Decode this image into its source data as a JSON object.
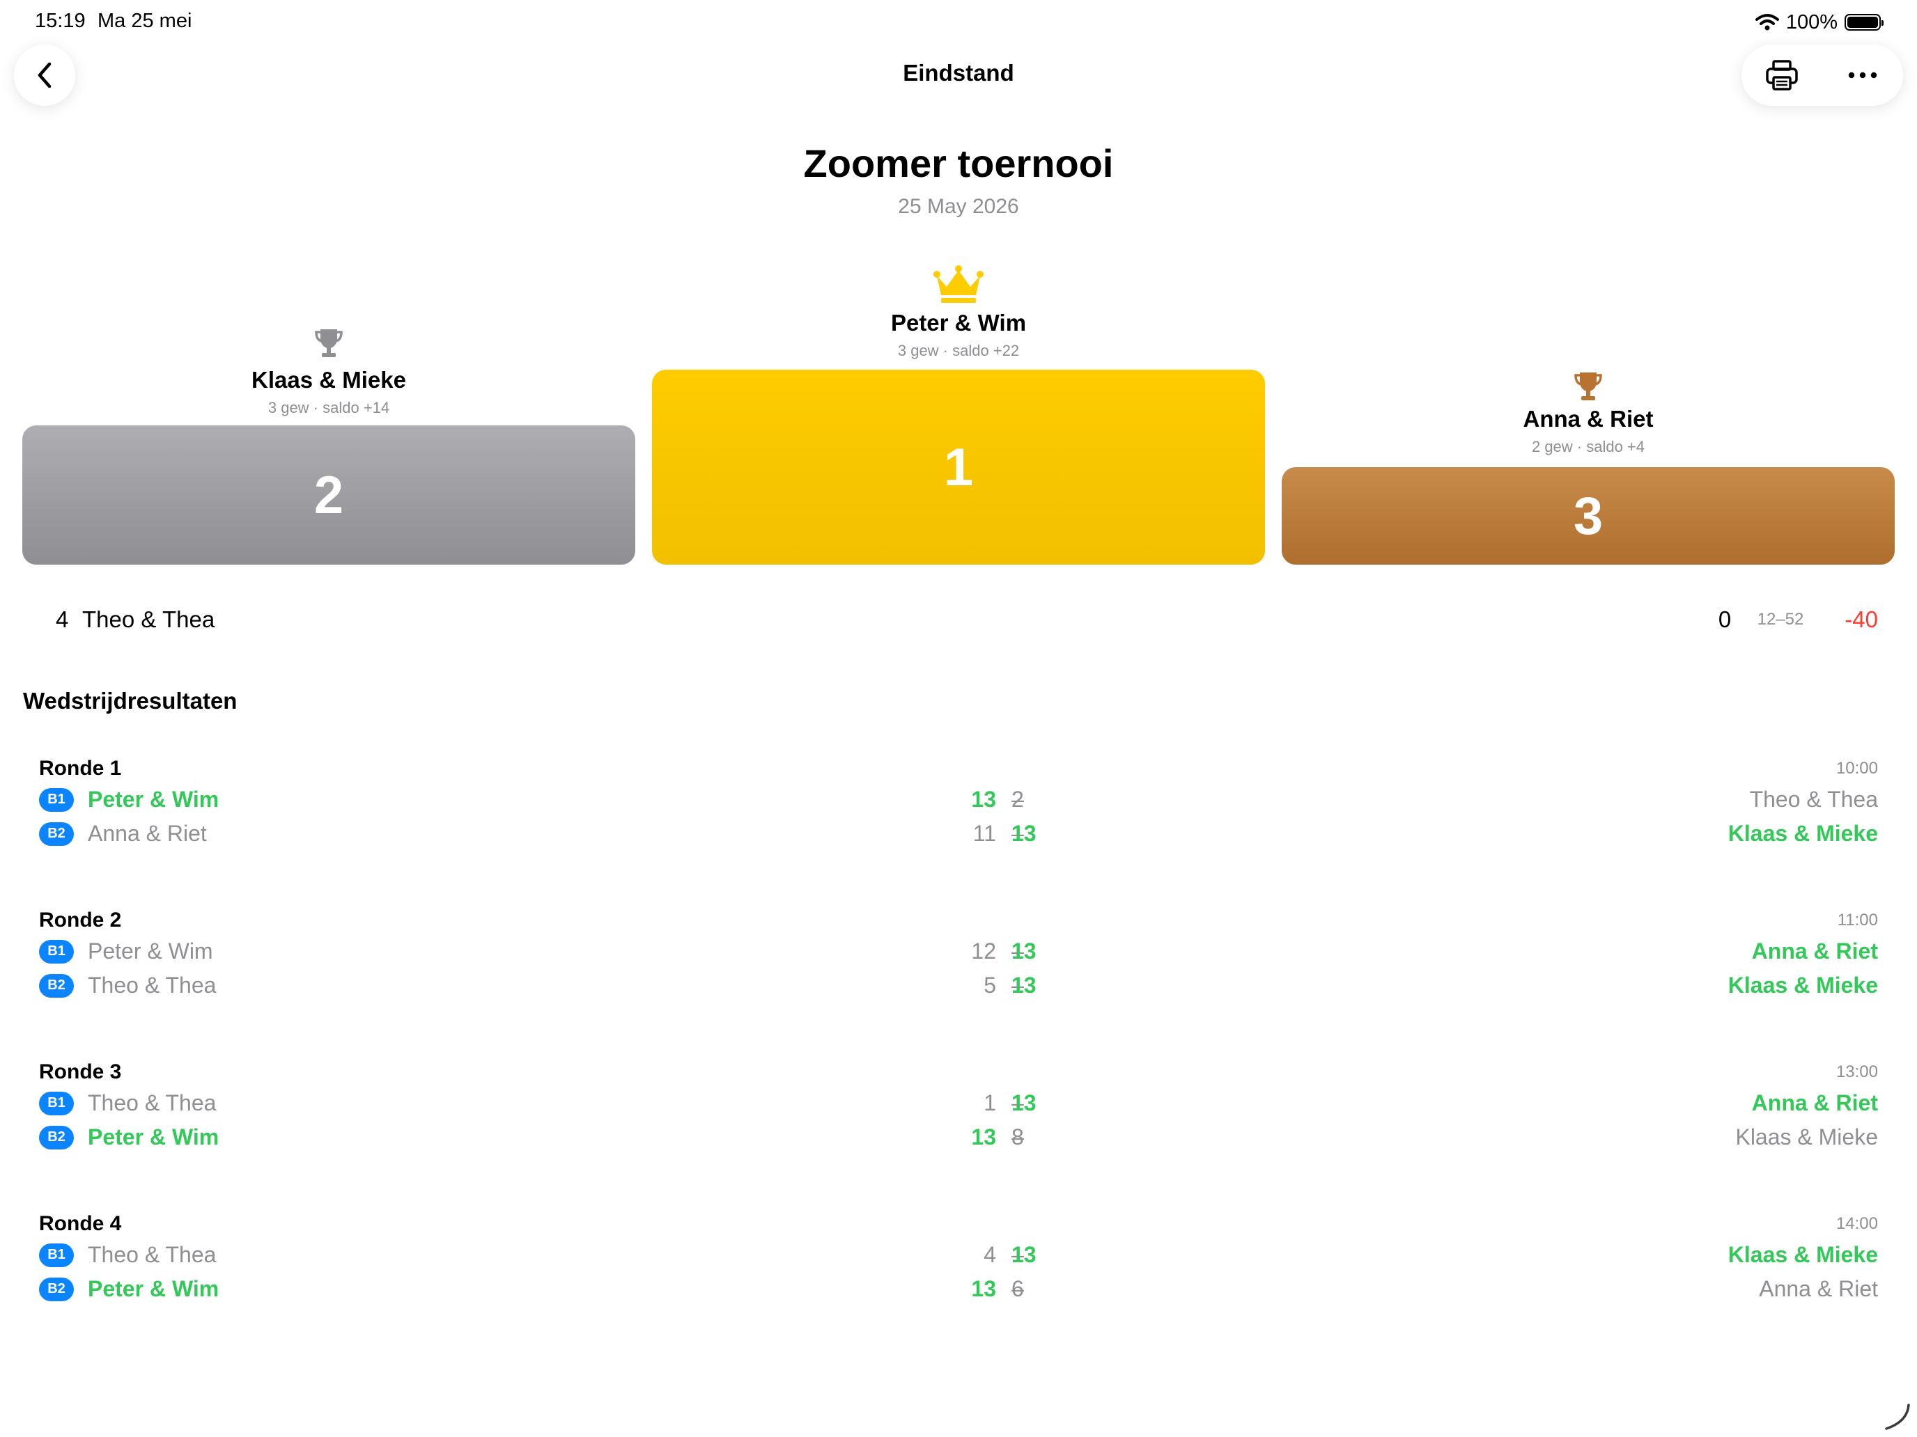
{
  "status_bar": {
    "time": "15:19",
    "date": "Ma 25 mei",
    "battery": "100%"
  },
  "nav": {
    "title": "Eindstand"
  },
  "header": {
    "title": "Zoomer toernooi",
    "date": "25 May 2026"
  },
  "podium": {
    "first": {
      "team": "Peter & Wim",
      "stats": "3 gew · saldo +22",
      "rank": "1"
    },
    "second": {
      "team": "Klaas & Mieke",
      "stats": "3 gew · saldo +14",
      "rank": "2"
    },
    "third": {
      "team": "Anna & Riet",
      "stats": "2 gew · saldo +4",
      "rank": "3"
    }
  },
  "other_standings": [
    {
      "rank": "4",
      "team": "Theo & Thea",
      "wins": "0",
      "points": "12–52",
      "saldo": "-40"
    }
  ],
  "results": {
    "section_title": "Wedstrijdresultaten",
    "rounds": [
      {
        "title": "Ronde 1",
        "time": "10:00",
        "matches": [
          {
            "court": "B1",
            "team_a": "Peter & Wim",
            "score_a": "13",
            "dash": "–",
            "score_b": "2",
            "team_b": "Theo & Thea"
          },
          {
            "court": "B2",
            "team_a": "Anna & Riet",
            "score_a": "11",
            "dash": "–",
            "score_b": "13",
            "team_b": "Klaas & Mieke"
          }
        ]
      },
      {
        "title": "Ronde 2",
        "time": "11:00",
        "matches": [
          {
            "court": "B1",
            "team_a": "Peter & Wim",
            "score_a": "12",
            "dash": "–",
            "score_b": "13",
            "team_b": "Anna & Riet"
          },
          {
            "court": "B2",
            "team_a": "Theo & Thea",
            "score_a": "5",
            "dash": "–",
            "score_b": "13",
            "team_b": "Klaas & Mieke"
          }
        ]
      },
      {
        "title": "Ronde 3",
        "time": "13:00",
        "matches": [
          {
            "court": "B1",
            "team_a": "Theo & Thea",
            "score_a": "1",
            "dash": "–",
            "score_b": "13",
            "team_b": "Anna & Riet"
          },
          {
            "court": "B2",
            "team_a": "Peter & Wim",
            "score_a": "13",
            "dash": "–",
            "score_b": "8",
            "team_b": "Klaas & Mieke"
          }
        ]
      },
      {
        "title": "Ronde 4",
        "time": "14:00",
        "matches": [
          {
            "court": "B1",
            "team_a": "Theo & Thea",
            "score_a": "4",
            "dash": "–",
            "score_b": "13",
            "team_b": "Klaas & Mieke"
          },
          {
            "court": "B2",
            "team_a": "Peter & Wim",
            "score_a": "13",
            "dash": "–",
            "score_b": "6",
            "team_b": "Anna & Riet"
          }
        ]
      }
    ]
  },
  "colors": {
    "winner": "#34c759",
    "badge": "#0a84ff",
    "gold": "#ffcc00",
    "silver": "#8e8e93",
    "bronze": "#b87333",
    "negative": "#ff3b30"
  },
  "icons": {
    "back": "chevron-left-icon",
    "print": "printer-icon",
    "more": "ellipsis-icon",
    "first": "crown-icon",
    "second": "trophy-icon",
    "third": "trophy-icon"
  }
}
